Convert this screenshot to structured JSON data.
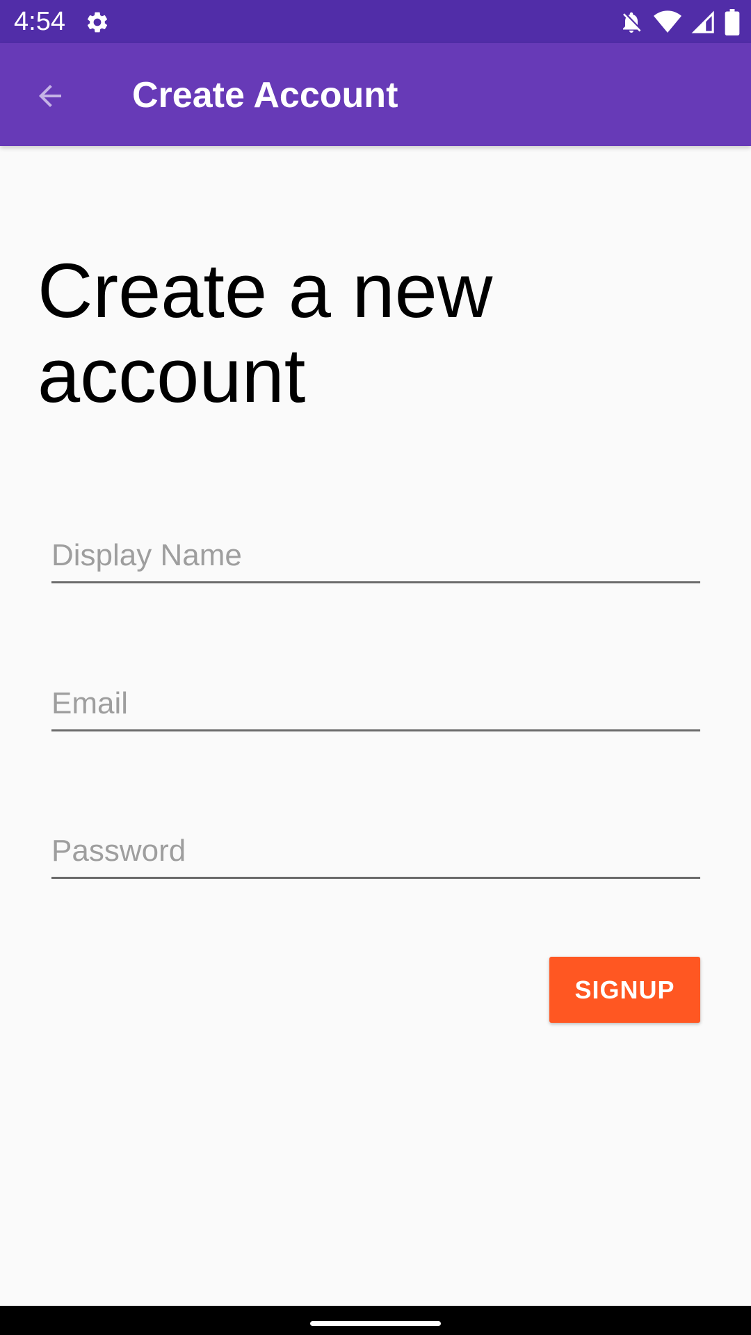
{
  "status_bar": {
    "time": "4:54",
    "icons": [
      "settings-icon",
      "notifications-off-icon",
      "wifi-icon",
      "signal-icon",
      "battery-icon"
    ],
    "background_color": "#512da8"
  },
  "app_bar": {
    "title": "Create Account",
    "back_icon": "arrow-back-icon",
    "background_color": "#673ab7"
  },
  "main": {
    "heading": "Create a new account",
    "fields": {
      "display_name": {
        "placeholder": "Display Name",
        "value": ""
      },
      "email": {
        "placeholder": "Email",
        "value": ""
      },
      "password": {
        "placeholder": "Password",
        "value": ""
      }
    },
    "signup_button": {
      "label": "SIGNUP",
      "color": "#ff5722"
    }
  },
  "nav_bar": {
    "gesture_handle": "home-handle"
  }
}
